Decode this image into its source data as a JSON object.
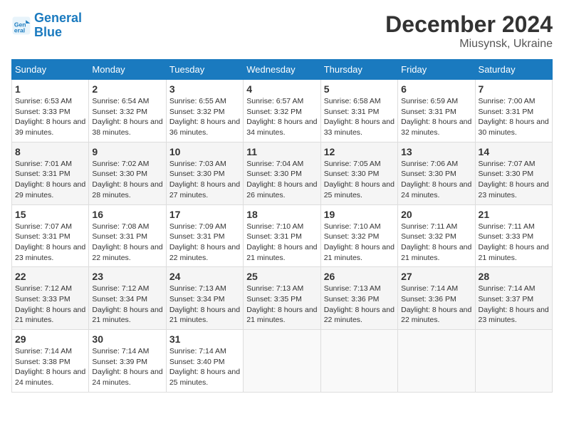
{
  "logo": {
    "line1": "General",
    "line2": "Blue"
  },
  "title": {
    "month": "December 2024",
    "location": "Miusynsk, Ukraine"
  },
  "headers": [
    "Sunday",
    "Monday",
    "Tuesday",
    "Wednesday",
    "Thursday",
    "Friday",
    "Saturday"
  ],
  "weeks": [
    [
      {
        "day": "1",
        "sunrise": "6:53 AM",
        "sunset": "3:33 PM",
        "daylight": "8 hours and 39 minutes."
      },
      {
        "day": "2",
        "sunrise": "6:54 AM",
        "sunset": "3:32 PM",
        "daylight": "8 hours and 38 minutes."
      },
      {
        "day": "3",
        "sunrise": "6:55 AM",
        "sunset": "3:32 PM",
        "daylight": "8 hours and 36 minutes."
      },
      {
        "day": "4",
        "sunrise": "6:57 AM",
        "sunset": "3:32 PM",
        "daylight": "8 hours and 34 minutes."
      },
      {
        "day": "5",
        "sunrise": "6:58 AM",
        "sunset": "3:31 PM",
        "daylight": "8 hours and 33 minutes."
      },
      {
        "day": "6",
        "sunrise": "6:59 AM",
        "sunset": "3:31 PM",
        "daylight": "8 hours and 32 minutes."
      },
      {
        "day": "7",
        "sunrise": "7:00 AM",
        "sunset": "3:31 PM",
        "daylight": "8 hours and 30 minutes."
      }
    ],
    [
      {
        "day": "8",
        "sunrise": "7:01 AM",
        "sunset": "3:31 PM",
        "daylight": "8 hours and 29 minutes."
      },
      {
        "day": "9",
        "sunrise": "7:02 AM",
        "sunset": "3:30 PM",
        "daylight": "8 hours and 28 minutes."
      },
      {
        "day": "10",
        "sunrise": "7:03 AM",
        "sunset": "3:30 PM",
        "daylight": "8 hours and 27 minutes."
      },
      {
        "day": "11",
        "sunrise": "7:04 AM",
        "sunset": "3:30 PM",
        "daylight": "8 hours and 26 minutes."
      },
      {
        "day": "12",
        "sunrise": "7:05 AM",
        "sunset": "3:30 PM",
        "daylight": "8 hours and 25 minutes."
      },
      {
        "day": "13",
        "sunrise": "7:06 AM",
        "sunset": "3:30 PM",
        "daylight": "8 hours and 24 minutes."
      },
      {
        "day": "14",
        "sunrise": "7:07 AM",
        "sunset": "3:30 PM",
        "daylight": "8 hours and 23 minutes."
      }
    ],
    [
      {
        "day": "15",
        "sunrise": "7:07 AM",
        "sunset": "3:31 PM",
        "daylight": "8 hours and 23 minutes."
      },
      {
        "day": "16",
        "sunrise": "7:08 AM",
        "sunset": "3:31 PM",
        "daylight": "8 hours and 22 minutes."
      },
      {
        "day": "17",
        "sunrise": "7:09 AM",
        "sunset": "3:31 PM",
        "daylight": "8 hours and 22 minutes."
      },
      {
        "day": "18",
        "sunrise": "7:10 AM",
        "sunset": "3:31 PM",
        "daylight": "8 hours and 21 minutes."
      },
      {
        "day": "19",
        "sunrise": "7:10 AM",
        "sunset": "3:32 PM",
        "daylight": "8 hours and 21 minutes."
      },
      {
        "day": "20",
        "sunrise": "7:11 AM",
        "sunset": "3:32 PM",
        "daylight": "8 hours and 21 minutes."
      },
      {
        "day": "21",
        "sunrise": "7:11 AM",
        "sunset": "3:33 PM",
        "daylight": "8 hours and 21 minutes."
      }
    ],
    [
      {
        "day": "22",
        "sunrise": "7:12 AM",
        "sunset": "3:33 PM",
        "daylight": "8 hours and 21 minutes."
      },
      {
        "day": "23",
        "sunrise": "7:12 AM",
        "sunset": "3:34 PM",
        "daylight": "8 hours and 21 minutes."
      },
      {
        "day": "24",
        "sunrise": "7:13 AM",
        "sunset": "3:34 PM",
        "daylight": "8 hours and 21 minutes."
      },
      {
        "day": "25",
        "sunrise": "7:13 AM",
        "sunset": "3:35 PM",
        "daylight": "8 hours and 21 minutes."
      },
      {
        "day": "26",
        "sunrise": "7:13 AM",
        "sunset": "3:36 PM",
        "daylight": "8 hours and 22 minutes."
      },
      {
        "day": "27",
        "sunrise": "7:14 AM",
        "sunset": "3:36 PM",
        "daylight": "8 hours and 22 minutes."
      },
      {
        "day": "28",
        "sunrise": "7:14 AM",
        "sunset": "3:37 PM",
        "daylight": "8 hours and 23 minutes."
      }
    ],
    [
      {
        "day": "29",
        "sunrise": "7:14 AM",
        "sunset": "3:38 PM",
        "daylight": "8 hours and 24 minutes."
      },
      {
        "day": "30",
        "sunrise": "7:14 AM",
        "sunset": "3:39 PM",
        "daylight": "8 hours and 24 minutes."
      },
      {
        "day": "31",
        "sunrise": "7:14 AM",
        "sunset": "3:40 PM",
        "daylight": "8 hours and 25 minutes."
      },
      null,
      null,
      null,
      null
    ]
  ]
}
